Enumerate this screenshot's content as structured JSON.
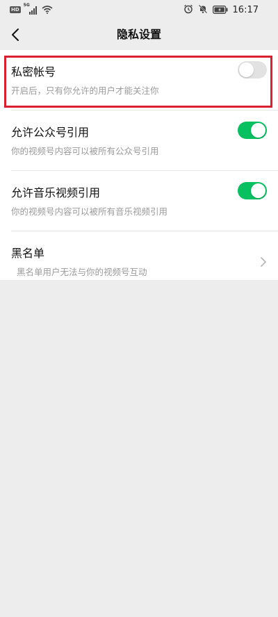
{
  "status_bar": {
    "network_badge": "HD",
    "network_type": "5G",
    "time": "16:17",
    "icons": [
      "signal-icon",
      "wifi-icon",
      "alarm-icon",
      "mute-icon",
      "battery-icon"
    ]
  },
  "header": {
    "title": "隐私设置",
    "back_icon": "chevron-left-icon"
  },
  "settings": [
    {
      "title": "私密帐号",
      "description": "开启后，只有你允许的用户才能关注你",
      "control": "toggle",
      "enabled": false
    },
    {
      "title": "允许公众号引用",
      "description": "你的视频号内容可以被所有公众号引用",
      "control": "toggle",
      "enabled": true
    },
    {
      "title": "允许音乐视频引用",
      "description": "你的视频号内容可以被所有音乐视频引用",
      "control": "toggle",
      "enabled": true
    },
    {
      "title": "黑名单",
      "description": "黑名单用户无法与你的视频号互动",
      "control": "chevron"
    }
  ],
  "colors": {
    "toggle_on": "#07c160",
    "toggle_off": "#e2e2e2",
    "highlight_border": "#d9202e",
    "background": "#ededed"
  }
}
